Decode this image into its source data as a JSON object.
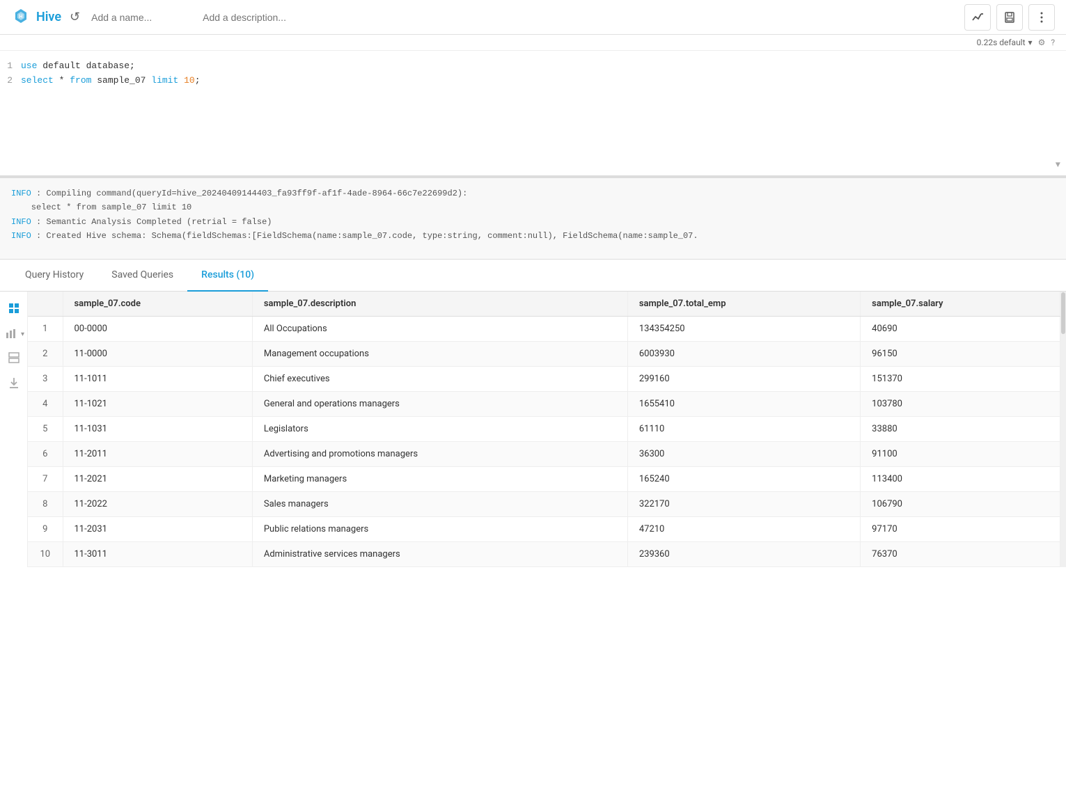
{
  "header": {
    "app_name": "Hive",
    "name_placeholder": "Add a name...",
    "desc_placeholder": "Add a description...",
    "history_icon": "↺",
    "btn_chart": "📈",
    "btn_save": "💾",
    "btn_more": "⋮"
  },
  "timebar": {
    "time_value": "0.22s default",
    "settings_icon": "⚙",
    "help_icon": "?"
  },
  "editor": {
    "lines": [
      {
        "num": "1",
        "content_plain": "use default database;"
      },
      {
        "num": "2",
        "content_plain": "select * from sample_07 limit 10;"
      }
    ]
  },
  "log": {
    "lines": [
      "INFO  : Compiling command(queryId=hive_20240409144403_fa93ff9f-af1f-4ade-8964-66c7e22699d2):",
      "select * from sample_07 limit 10",
      "INFO  : Semantic Analysis Completed (retrial = false)",
      "INFO  : Created Hive schema: Schema(fieldSchemas:[FieldSchema(name:sample_07.code, type:string, comment:null), FieldSchema(name:sample_07."
    ]
  },
  "tabs": [
    {
      "id": "history",
      "label": "Query History"
    },
    {
      "id": "saved",
      "label": "Saved Queries"
    },
    {
      "id": "results",
      "label": "Results (10)",
      "active": true
    }
  ],
  "table": {
    "columns": [
      {
        "id": "row_num",
        "label": ""
      },
      {
        "id": "code",
        "label": "sample_07.code"
      },
      {
        "id": "description",
        "label": "sample_07.description"
      },
      {
        "id": "total_emp",
        "label": "sample_07.total_emp"
      },
      {
        "id": "salary",
        "label": "sample_07.salary"
      }
    ],
    "rows": [
      {
        "row_num": 1,
        "code": "00-0000",
        "description": "All Occupations",
        "total_emp": "134354250",
        "salary": "40690"
      },
      {
        "row_num": 2,
        "code": "11-0000",
        "description": "Management occupations",
        "total_emp": "6003930",
        "salary": "96150"
      },
      {
        "row_num": 3,
        "code": "11-1011",
        "description": "Chief executives",
        "total_emp": "299160",
        "salary": "151370"
      },
      {
        "row_num": 4,
        "code": "11-1021",
        "description": "General and operations managers",
        "total_emp": "1655410",
        "salary": "103780"
      },
      {
        "row_num": 5,
        "code": "11-1031",
        "description": "Legislators",
        "total_emp": "61110",
        "salary": "33880"
      },
      {
        "row_num": 6,
        "code": "11-2011",
        "description": "Advertising and promotions managers",
        "total_emp": "36300",
        "salary": "91100"
      },
      {
        "row_num": 7,
        "code": "11-2021",
        "description": "Marketing managers",
        "total_emp": "165240",
        "salary": "113400"
      },
      {
        "row_num": 8,
        "code": "11-2022",
        "description": "Sales managers",
        "total_emp": "322170",
        "salary": "106790"
      },
      {
        "row_num": 9,
        "code": "11-2031",
        "description": "Public relations managers",
        "total_emp": "47210",
        "salary": "97170"
      },
      {
        "row_num": 10,
        "code": "11-3011",
        "description": "Administrative services managers",
        "total_emp": "239360",
        "salary": "76370"
      }
    ]
  }
}
